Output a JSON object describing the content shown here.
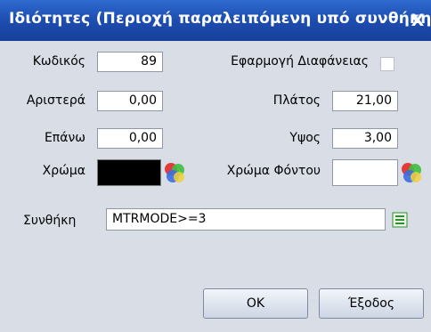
{
  "dialog": {
    "title": "Ιδιότητες (Περιοχή παραλειπόμενη υπό συνθήκη)",
    "close_glyph": "X"
  },
  "fields": {
    "code_label": "Κωδικός",
    "code_value": "89",
    "left_label": "Αριστερά",
    "left_value": "0,00",
    "top_label": "Επάνω",
    "top_value": "0,00",
    "color_label": "Χρώμα",
    "color_value": "#000000",
    "transparency_label": "Εφαρμογή Διαφάνειας",
    "transparency_checked": false,
    "width_label": "Πλάτος",
    "width_value": "21,00",
    "height_label": "Υψος",
    "height_value": "3,00",
    "bgcolor_label": "Χρώμα Φόντου",
    "bgcolor_value": "#ffffff",
    "condition_label": "Συνθήκη",
    "condition_value": "MTRMODE>=3"
  },
  "buttons": {
    "ok_label": "OK",
    "exit_label": "Έξοδος"
  },
  "icons": {
    "color_picker": "color-palette-icon",
    "bgcolor_picker": "color-palette-icon",
    "condition_editor": "list-icon"
  }
}
